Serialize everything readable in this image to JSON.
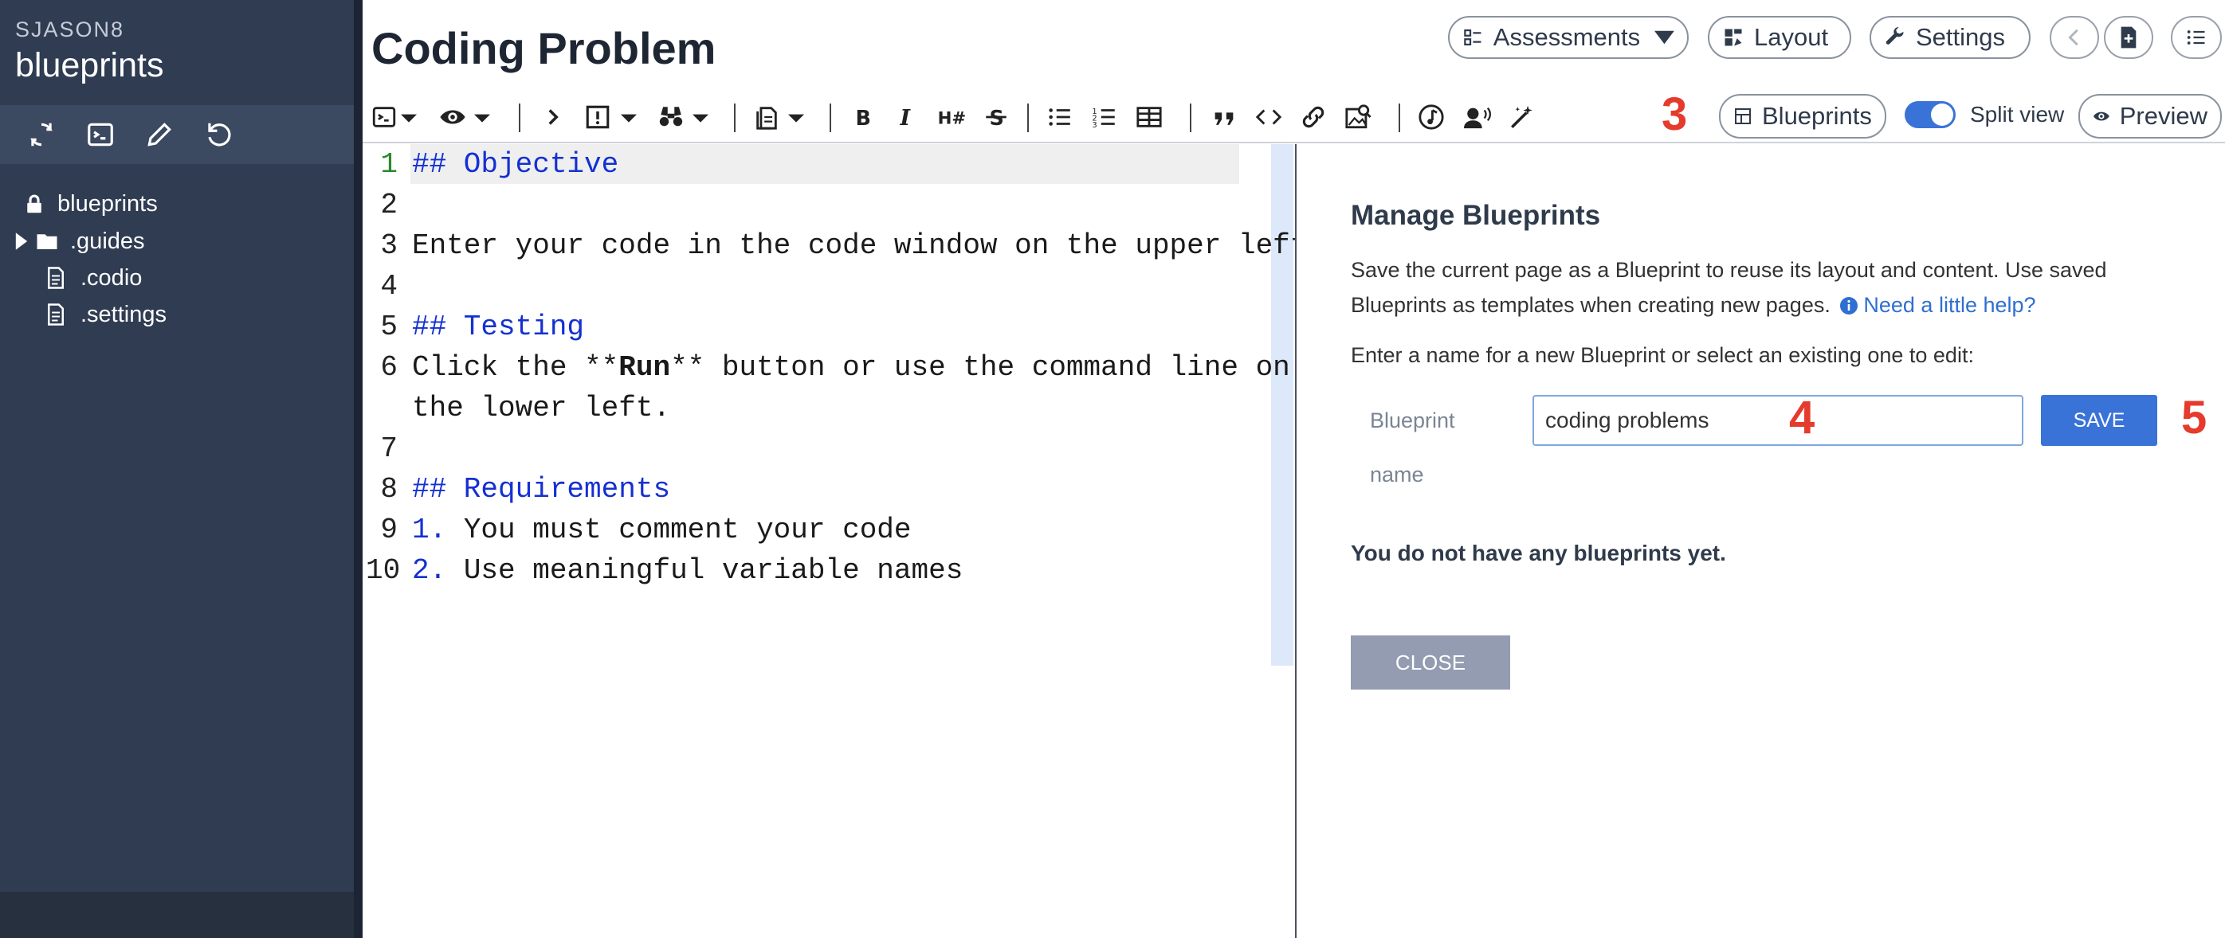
{
  "sidebar": {
    "user": "SJASON8",
    "project": "blueprints",
    "tree": [
      {
        "label": "blueprints",
        "icon": "lock-icon"
      },
      {
        "label": ".guides",
        "icon": "folder-icon"
      },
      {
        "label": ".codio",
        "icon": "file-icon"
      },
      {
        "label": ".settings",
        "icon": "file-icon"
      }
    ]
  },
  "header": {
    "title": "Coding Problem",
    "assessments_label": "Assessments",
    "layout_label": "Layout",
    "settings_label": "Settings"
  },
  "toolbar": {
    "blueprints_label": "Blueprints",
    "split_view_label": "Split view",
    "preview_label": "Preview",
    "split_view_on": true
  },
  "annotations": {
    "a3": "3",
    "a4": "4",
    "a5": "5"
  },
  "editor": {
    "lines": [
      {
        "num": "1",
        "md": "## Objective",
        "text": ""
      },
      {
        "num": "2",
        "md": "",
        "text": ""
      },
      {
        "num": "3",
        "md": "",
        "text": "Enter your code in the code window on the upper left."
      },
      {
        "num": "4",
        "md": "",
        "text": ""
      },
      {
        "num": "5",
        "md": "## Testing",
        "text": ""
      },
      {
        "num": "6",
        "md": "",
        "text": "Click the **",
        "bold": "Run",
        "text2": "** button or use the command line on",
        "wrap": "the lower left."
      },
      {
        "num": "7",
        "md": "",
        "text": ""
      },
      {
        "num": "8",
        "md": "## Requirements",
        "text": ""
      },
      {
        "num": "9",
        "md": "1.",
        "text": " You must comment your code"
      },
      {
        "num": "10",
        "md": "2.",
        "text": " Use meaningful variable names"
      }
    ]
  },
  "blueprints_panel": {
    "title": "Manage Blueprints",
    "description": "Save the current page as a Blueprint to reuse its layout and content. Use saved Blueprints as templates when creating new pages.",
    "help_link": "Need a little help?",
    "prompt": "Enter a name for a new Blueprint or select an existing one to edit:",
    "name_label_1": "Blueprint",
    "name_label_2": "name",
    "name_value": "coding problems",
    "save_label": "SAVE",
    "empty_message": "You do not have any blueprints yet.",
    "close_label": "CLOSE"
  },
  "colors": {
    "accent": "#3a73d8",
    "sidebar": "#2f3c52",
    "annotation": "#e53b2c"
  }
}
